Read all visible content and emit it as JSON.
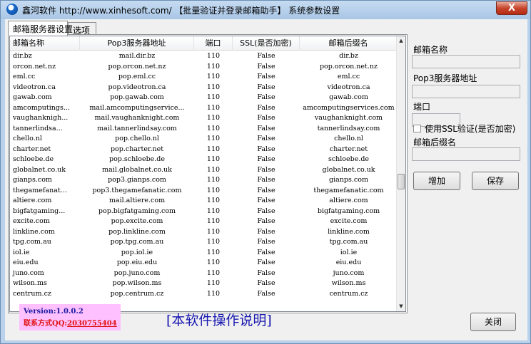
{
  "window": {
    "title": "鑫河软件 http://www.xinhesoft.com/ 【批量验证并登录邮箱助手】 系统参数设置",
    "close_label": "X"
  },
  "tabs": [
    {
      "label": "邮箱服务器设置",
      "active": true
    },
    {
      "label": "选项",
      "active": false
    }
  ],
  "table": {
    "columns": [
      "邮箱名称",
      "Pop3服务器地址",
      "端口",
      "SSL(是否加密)",
      "邮箱后缀名"
    ],
    "rows": [
      [
        "dir.bz",
        "mail.dir.bz",
        "110",
        "False",
        "dir.bz"
      ],
      [
        "orcon.net.nz",
        "pop.orcon.net.nz",
        "110",
        "False",
        "pop.orcon.net.nz"
      ],
      [
        "eml.cc",
        "pop.eml.cc",
        "110",
        "False",
        "eml.cc"
      ],
      [
        "videotron.ca",
        "pop.videotron.ca",
        "110",
        "False",
        "videotron.ca"
      ],
      [
        "gawab.com",
        "pop.gawab.com",
        "110",
        "False",
        "gawab.com"
      ],
      [
        "amcomputings...",
        "mail.amcomputingservice...",
        "110",
        "False",
        "amcomputingservices.com"
      ],
      [
        "vaughanknigh...",
        "mail.vaughanknight.com",
        "110",
        "False",
        "vaughanknight.com"
      ],
      [
        "tannerlindsa...",
        "mail.tannerlindsay.com",
        "110",
        "False",
        "tannerlindsay.com"
      ],
      [
        "chello.nl",
        "pop.chello.nl",
        "110",
        "False",
        "chello.nl"
      ],
      [
        "charter.net",
        "pop.charter.net",
        "110",
        "False",
        "charter.net"
      ],
      [
        "schloebe.de",
        "pop.schloebe.de",
        "110",
        "False",
        "schloebe.de"
      ],
      [
        "globalnet.co.uk",
        "mail.globalnet.co.uk",
        "110",
        "False",
        "globalnet.co.uk"
      ],
      [
        "gianps.com",
        "pop3.gianps.com",
        "110",
        "False",
        "gianps.com"
      ],
      [
        "thegamefanat...",
        "pop3.thegamefanatic.com",
        "110",
        "False",
        "thegamefanatic.com"
      ],
      [
        "altiere.com",
        "mail.altiere.com",
        "110",
        "False",
        "altiere.com"
      ],
      [
        "bigfatgaming...",
        "pop.bigfatgaming.com",
        "110",
        "False",
        "bigfatgaming.com"
      ],
      [
        "excite.com",
        "pop.excite.com",
        "110",
        "False",
        "excite.com"
      ],
      [
        "linkline.com",
        "pop.linkline.com",
        "110",
        "False",
        "linkline.com"
      ],
      [
        "tpg.com.au",
        "pop.tpg.com.au",
        "110",
        "False",
        "tpg.com.au"
      ],
      [
        "iol.ie",
        "pop.iol.ie",
        "110",
        "False",
        "iol.ie"
      ],
      [
        "eiu.edu",
        "pop.eiu.edu",
        "110",
        "False",
        "eiu.edu"
      ],
      [
        "juno.com",
        "pop.juno.com",
        "110",
        "False",
        "juno.com"
      ],
      [
        "wilson.ms",
        "pop.wilson.ms",
        "110",
        "False",
        "wilson.ms"
      ],
      [
        "centrum.cz",
        "pop.centrum.cz",
        "110",
        "False",
        "centrum.cz"
      ]
    ]
  },
  "form": {
    "mailbox_name_label": "邮箱名称",
    "mailbox_name_value": "",
    "pop3_label": "Pop3服务器地址",
    "pop3_value": "",
    "port_label": "端口",
    "port_value": "",
    "ssl_label": "使用SSL验证(是否加密)",
    "ssl_checked": false,
    "suffix_label": "邮箱后缀名",
    "suffix_value": "",
    "add_label": "增加",
    "save_label": "保存"
  },
  "footer": {
    "version": "Version:1.0.0.2",
    "contact_prefix": "联系方式QQ:",
    "contact_qq": "2030755404",
    "help_link": "[本软件操作说明]",
    "close_label": "关闭"
  },
  "colors": {
    "version_bg": "#ffc0ff",
    "version_text": "#1a1aa0",
    "contact_text": "#e01010",
    "help_link": "#1818b0"
  }
}
